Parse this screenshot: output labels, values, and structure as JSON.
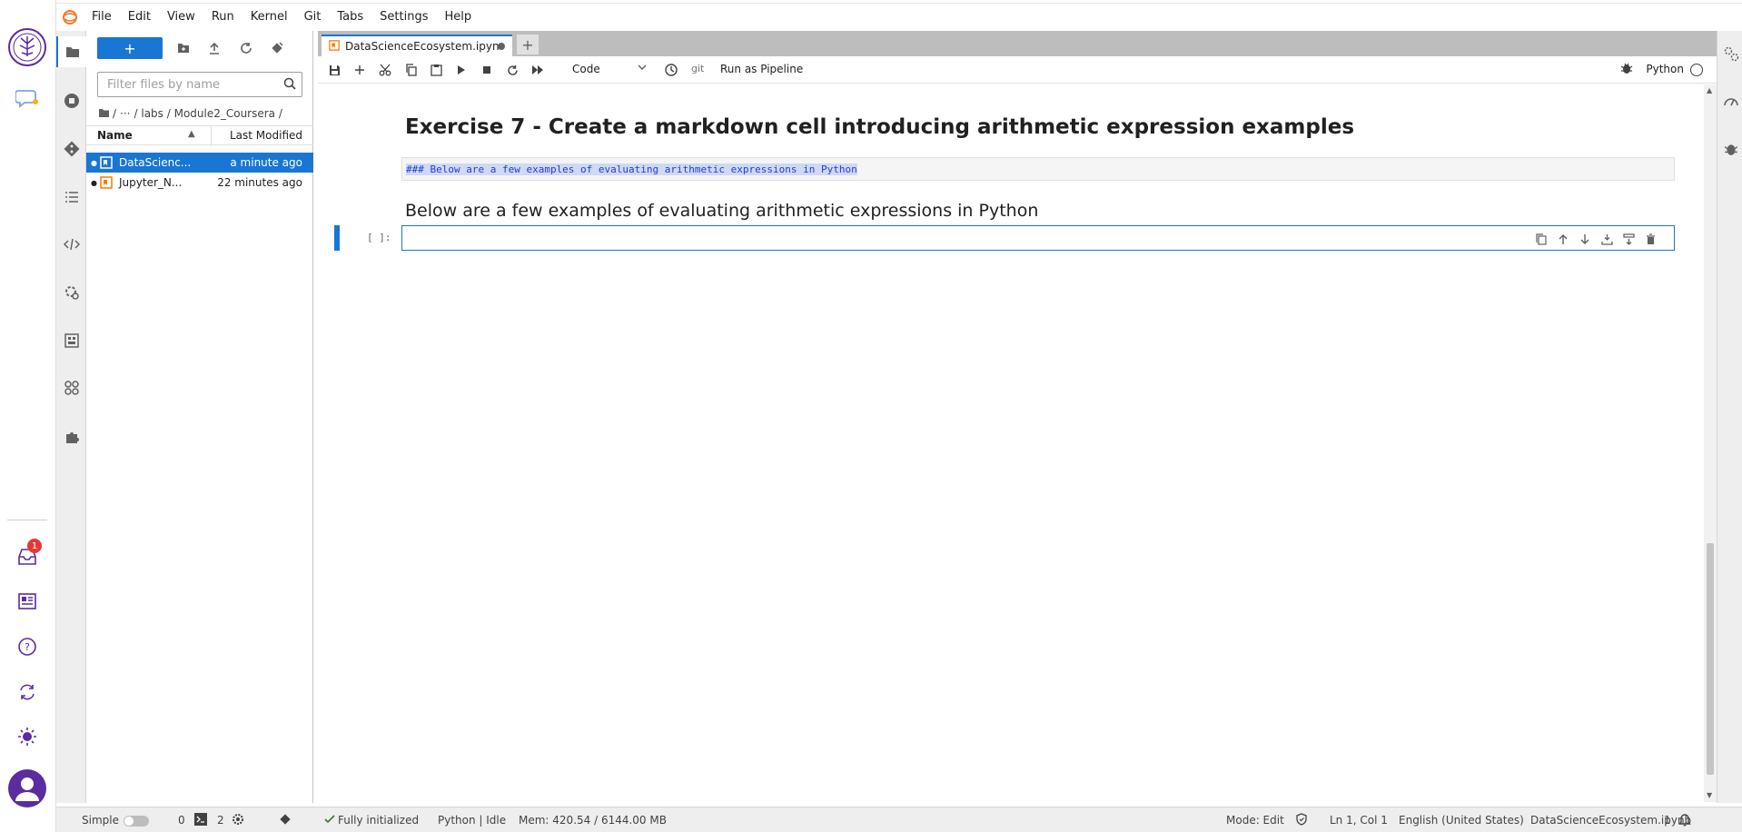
{
  "menu": [
    "File",
    "Edit",
    "View",
    "Run",
    "Kernel",
    "Git",
    "Tabs",
    "Settings",
    "Help"
  ],
  "filebrowser": {
    "new_label": "+",
    "filter_placeholder": "Filter files by name",
    "breadcrumbs": [
      "/",
      "···",
      "/ labs / Module2_Coursera /"
    ],
    "columns": {
      "name": "Name",
      "modified": "Last Modified"
    },
    "rows": [
      {
        "name": "DataScienc...",
        "modified": "a minute ago",
        "selected": true
      },
      {
        "name": "Jupyter_N...",
        "modified": "22 minutes ago",
        "selected": false
      }
    ]
  },
  "tabs": [
    {
      "label": "DataScienceEcosystem.ipyn",
      "dirty": true
    }
  ],
  "notebook_toolbar": {
    "cell_type": "Code",
    "git_label": "git",
    "run_pipeline": "Run as Pipeline",
    "kernel_name": "Python"
  },
  "notebook": {
    "heading1": "Exercise 7 - Create a markdown cell introducing arithmetic expression examples",
    "markdown_source": "### Below are a few examples of evaluating arithmetic expressions in Python",
    "heading3": "Below are a few examples of evaluating arithmetic expressions in Python",
    "prompt": "[ ]:"
  },
  "rail": {
    "notification_count": "1"
  },
  "statusbar": {
    "mode_label": "Simple",
    "terminals": "0",
    "kernels": "2",
    "initialized": "Fully initialized",
    "kernel_state": "Python | Idle",
    "memory": "Mem: 420.54 / 6144.00 MB",
    "edit_mode": "Mode: Edit",
    "cursor": "Ln 1, Col 1",
    "language": "English (United States)",
    "filename": "DataScienceEcosystem.ipynb",
    "notifications": "1"
  },
  "colors": {
    "accent": "#1976d2",
    "brand": "#5a2ca0",
    "notebook_icon": "#f57c00"
  }
}
